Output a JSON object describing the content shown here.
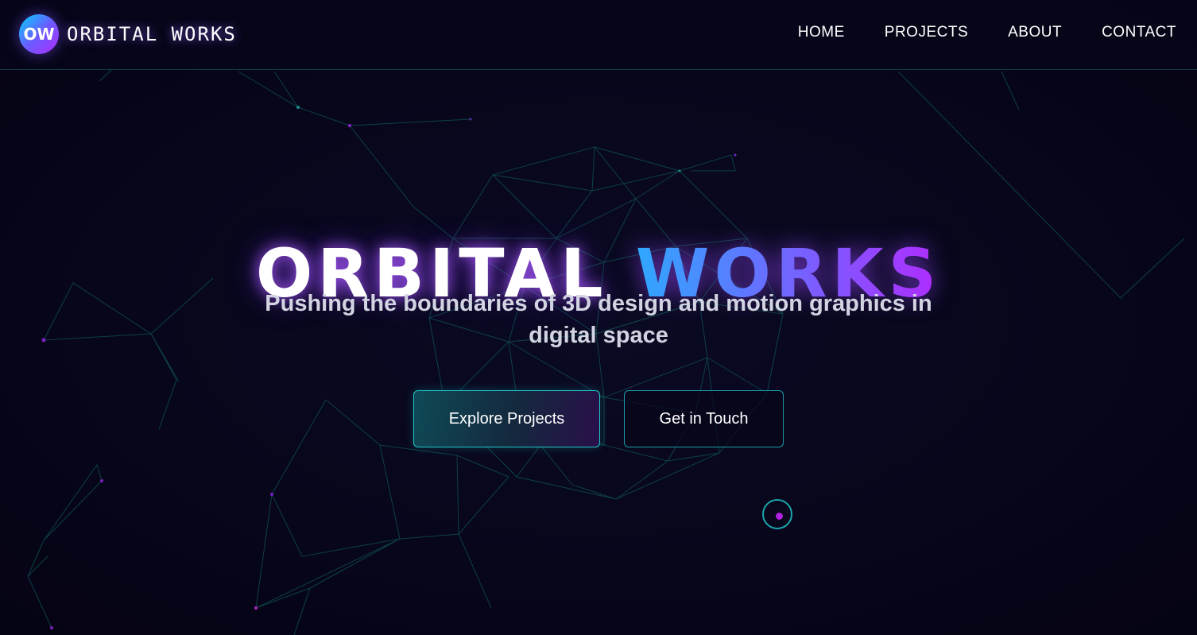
{
  "header": {
    "logo_badge": "OW",
    "logo_text": "ORBITAL WORKS",
    "nav": [
      "HOME",
      "PROJECTS",
      "ABOUT",
      "CONTACT"
    ]
  },
  "hero": {
    "title_word1": "ORBITAL",
    "title_word2": "WORKS",
    "subtitle": "Pushing the boundaries of 3D design and motion graphics in digital space",
    "primary_button": "Explore Projects",
    "secondary_button": "Get in Touch"
  },
  "colors": {
    "background": "#07061a",
    "accent_cyan": "#1fc6c6",
    "accent_blue": "#2fa8ff",
    "accent_purple": "#b02cff"
  },
  "icons": {
    "cursor": "cursor-ring-icon"
  }
}
